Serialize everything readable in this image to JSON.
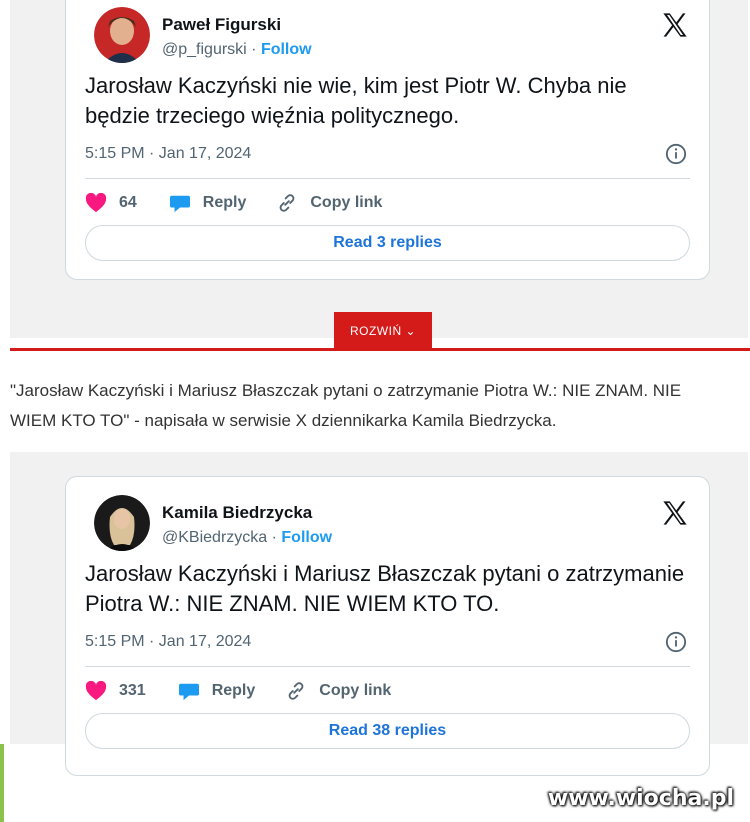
{
  "tweets": [
    {
      "name": "Paweł Figurski",
      "handle": "@p_figurski",
      "separator": " · ",
      "follow": "Follow",
      "text": "Jarosław Kaczyński nie wie, kim jest Piotr W. Chyba nie będzie trzeciego więźnia politycznego.",
      "time": "5:15 PM · Jan 17, 2024",
      "likes": "64",
      "reply": "Reply",
      "copy_link": "Copy link",
      "read_replies": "Read 3 replies"
    },
    {
      "name": "Kamila Biedrzycka",
      "handle": "@KBiedrzycka",
      "separator": " · ",
      "follow": "Follow",
      "text": "Jarosław Kaczyński i Mariusz Błaszczak pytani o zatrzymanie Piotra W.: NIE ZNAM. NIE WIEM KTO TO.",
      "time": "5:15 PM · Jan 17, 2024",
      "likes": "331",
      "reply": "Reply",
      "copy_link": "Copy link",
      "read_replies": "Read 38 replies"
    }
  ],
  "rozwin": "ROZWIŃ ⌄",
  "article_text": "\"Jarosław Kaczyński i Mariusz Błaszczak pytani o zatrzymanie Piotra W.: NIE ZNAM. NIE WIEM KTO TO\" - napisała w serwisie X dziennikarka Kamila Biedrzycka.",
  "watermark": "www.wiocha.pl",
  "colors": {
    "accent": "#1d9bf0",
    "heart": "#f91880",
    "red": "#d51a1a"
  }
}
